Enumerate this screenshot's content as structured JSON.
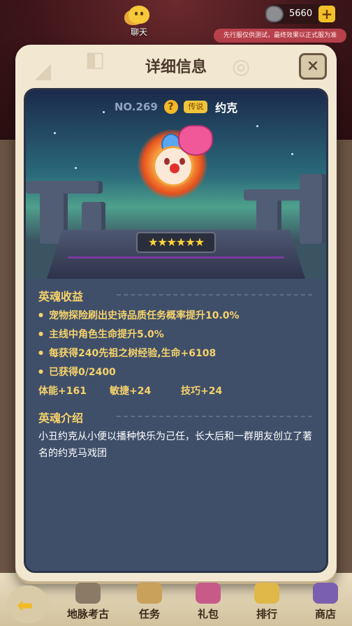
{
  "top_bar": {
    "chat_label": "聊天",
    "currency_value": "5660",
    "notice": "先行服仅供测试，最终效果以正式服为准"
  },
  "modal": {
    "title": "详细信息",
    "close_icon": "×"
  },
  "hero": {
    "number": "NO.269",
    "question_icon": "?",
    "rarity": "传说",
    "name": "约克",
    "stars": "★★★★★★"
  },
  "benefits": {
    "title": "英魂收益",
    "items": [
      "宠物探险刷出史诗品质任务概率提升10.0%",
      "主线中角色生命提升5.0%",
      "每获得240先祖之树经验,生命+6108",
      "已获得0/2400"
    ],
    "stats": [
      "体能+161",
      "敏捷+24",
      "技巧+24"
    ]
  },
  "intro": {
    "title": "英魂介绍",
    "text": "小丑约克从小便以播种快乐为己任，长大后和一群朋友创立了著名的约克马戏团"
  },
  "bottom_nav": {
    "items": [
      "地脉考古",
      "任务",
      "礼包",
      "排行",
      "商店"
    ],
    "back_icon": "arrow-left-icon"
  },
  "colors": {
    "accent_gold": "#f6d26a",
    "panel_blue": "#3f4f6a",
    "modal_cream": "#f2e7d1"
  }
}
